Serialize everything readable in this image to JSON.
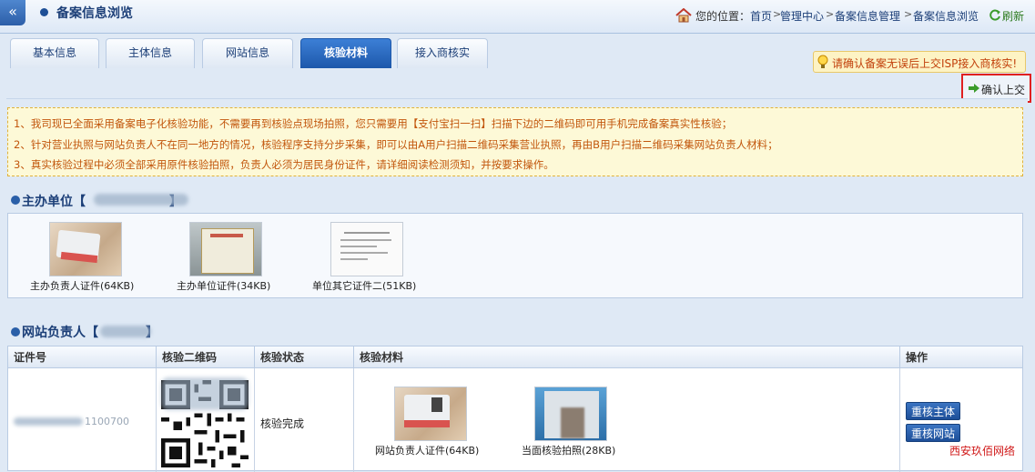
{
  "header": {
    "back_icon": "«",
    "title": "备案信息浏览",
    "location_label": "您的位置：",
    "breadcrumb": [
      "首页",
      "管理中心",
      "备案信息管理",
      "备案信息浏览"
    ],
    "refresh_label": "刷新"
  },
  "tabs": [
    {
      "label": "基本信息",
      "active": false
    },
    {
      "label": "主体信息",
      "active": false
    },
    {
      "label": "网站信息",
      "active": false
    },
    {
      "label": "核验材料",
      "active": true
    },
    {
      "label": "接入商核实",
      "active": false
    }
  ],
  "notice": {
    "text": "请确认备案无误后上交ISP接入商核实!"
  },
  "confirm_button": {
    "label": "确认上交"
  },
  "info_lines": [
    "1、我司现已全面采用备案电子化核验功能，不需要再到核验点现场拍照，您只需要用【支付宝扫一扫】扫描下边的二维码即可用手机完成备案真实性核验；",
    "2、针对营业执照与网站负责人不在同一地方的情况，核验程序支持分步采集，即可以由A用户扫描二维码采集营业执照，再由B用户扫描二维码采集网站负责人材料；",
    "3、真实核验过程中必须全部采用原件核验拍照，负责人必须为居民身份证件，请详细阅读检测须知，并按要求操作。"
  ],
  "sponsor": {
    "title_prefix": "主办单位【",
    "title_suffix": "】",
    "files": [
      {
        "caption": "主办负责人证件(64KB)"
      },
      {
        "caption": "主办单位证件(34KB)"
      },
      {
        "caption": "单位其它证件二(51KB)"
      }
    ]
  },
  "webmaster": {
    "title_prefix": "网站负责人【",
    "title_suffix": "】",
    "columns": [
      "证件号",
      "核验二维码",
      "核验状态",
      "核验材料",
      "操作"
    ],
    "row": {
      "id_number_tail": "1100700",
      "status": "核验完成",
      "files": [
        {
          "caption": "网站负责人证件(64KB)"
        },
        {
          "caption": "当面核验拍照(28KB)"
        }
      ],
      "actions": [
        "重核主体",
        "重核网站"
      ]
    }
  },
  "watermark": "西安玖佰网络",
  "colors": {
    "primary": "#1d58ab",
    "notice_text": "#c2410c",
    "highlight_border": "#e02020",
    "watermark": "#d01818"
  }
}
